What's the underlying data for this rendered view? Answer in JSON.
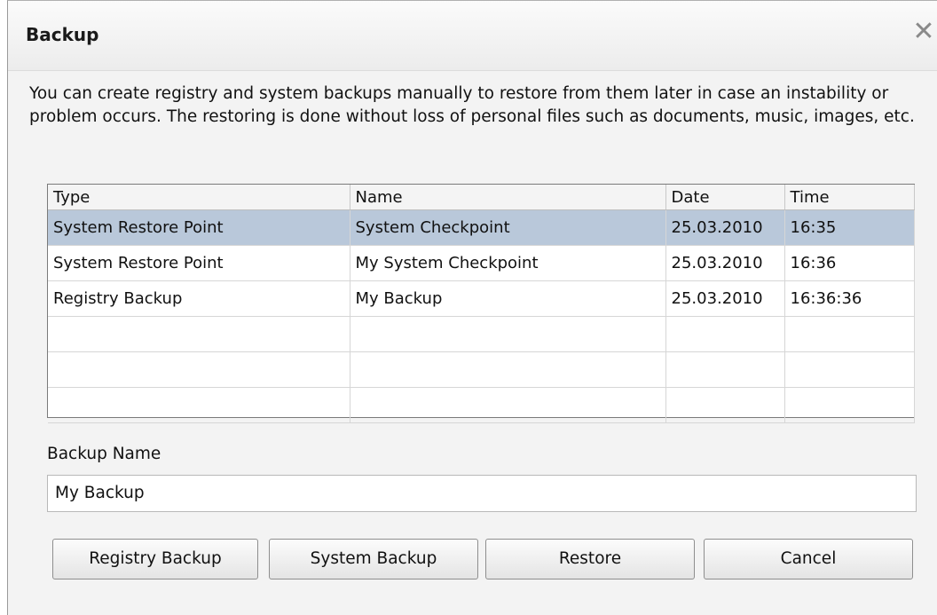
{
  "window": {
    "title": "Backup"
  },
  "description": "You can create registry and system backups manually to restore from them later in case an instability or problem occurs. The restoring is done without loss of personal files such as documents, music, images, etc.",
  "table": {
    "headers": [
      "Type",
      "Name",
      "Date",
      "Time"
    ],
    "rows": [
      [
        "System Restore Point",
        "System Checkpoint",
        "25.03.2010",
        "16:35"
      ],
      [
        "System Restore Point",
        "My System Checkpoint",
        "25.03.2010",
        "16:36"
      ],
      [
        "Registry Backup",
        "My Backup",
        "25.03.2010",
        "16:36:36"
      ]
    ],
    "selected_row": 0
  },
  "backup_name": {
    "label": "Backup Name",
    "value": "My Backup"
  },
  "buttons": {
    "registry_backup": "Registry Backup",
    "system_backup": "System Backup",
    "restore": "Restore",
    "cancel": "Cancel"
  },
  "icons": {
    "close": "close-icon"
  },
  "colors": {
    "selection": "#b9c8da"
  }
}
